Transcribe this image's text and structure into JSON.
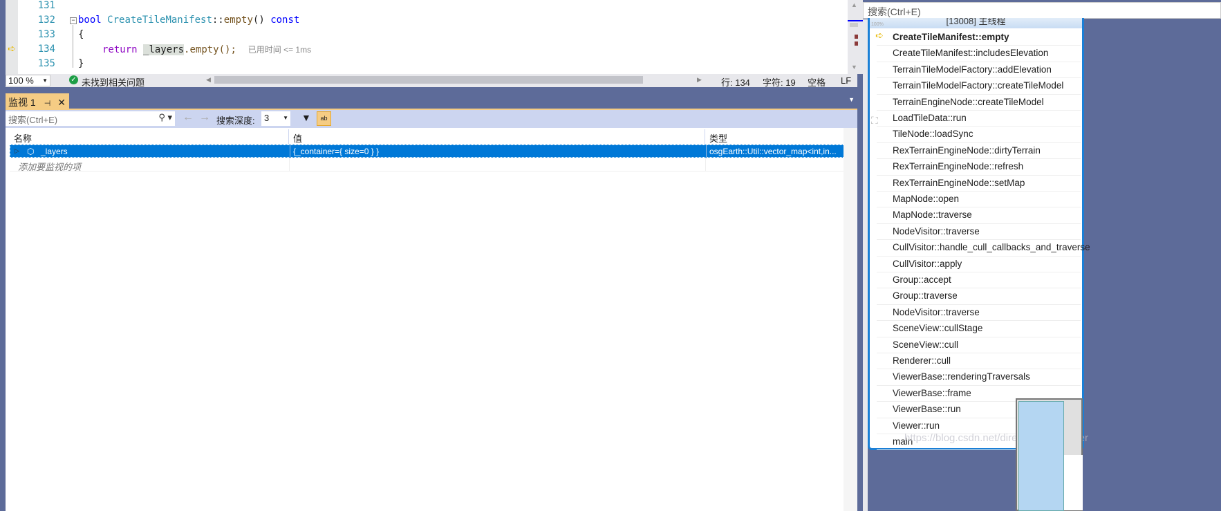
{
  "editor": {
    "lines": [
      {
        "num": "131"
      },
      {
        "num": "132",
        "kw1": "bool",
        "cls": "CreateTileManifest",
        "sep": "::",
        "fn": "empty",
        "paren": "()",
        "kw2": "const"
      },
      {
        "num": "133",
        "text": "{"
      },
      {
        "num": "134",
        "rt": "return",
        "var": "_layers",
        "rest": ".empty();",
        "hint": "已用时间 <= 1ms"
      },
      {
        "num": "135",
        "text": "}"
      }
    ],
    "zoom": "100 %",
    "issues": "未找到相关问题",
    "line_status": "行: 134",
    "char_status": "字符: 19",
    "whitespace": "空格",
    "eol": "LF"
  },
  "watch": {
    "tab_label": "监视 1",
    "search_placeholder": "搜索(Ctrl+E)",
    "depth_label": "搜索深度:",
    "depth_value": "3",
    "columns": [
      "名称",
      "值",
      "类型"
    ],
    "rows": [
      {
        "name": "_layers",
        "value": "{_container={ size=0 } }",
        "type": "osgEarth::Util::vector_map<int,in..."
      }
    ],
    "add_item": "添加要监视的项",
    "selection_color": "#0078d7"
  },
  "callstack": {
    "search_placeholder": "搜索(Ctrl+E)",
    "thread": "[13008] 主线程",
    "zoom_label": "100%",
    "frames": [
      "CreateTileManifest::empty",
      "CreateTileManifest::includesElevation",
      "TerrainTileModelFactory::addElevation",
      "TerrainTileModelFactory::createTileModel",
      "TerrainEngineNode::createTileModel",
      "LoadTileData::run",
      "TileNode::loadSync",
      "RexTerrainEngineNode::dirtyTerrain",
      "RexTerrainEngineNode::refresh",
      "RexTerrainEngineNode::setMap",
      "MapNode::open",
      "MapNode::traverse",
      "NodeVisitor::traverse",
      "CullVisitor::handle_cull_callbacks_and_traverse",
      "CullVisitor::apply",
      "Group::accept",
      "Group::traverse",
      "NodeVisitor::traverse",
      "SceneView::cullStage",
      "SceneView::cull",
      "Renderer::cull",
      "ViewerBase::renderingTraversals",
      "ViewerBase::frame",
      "ViewerBase::run",
      "Viewer::run",
      "main"
    ]
  },
  "watermark": "https://blog.csdn.net/directx3d_beginner"
}
